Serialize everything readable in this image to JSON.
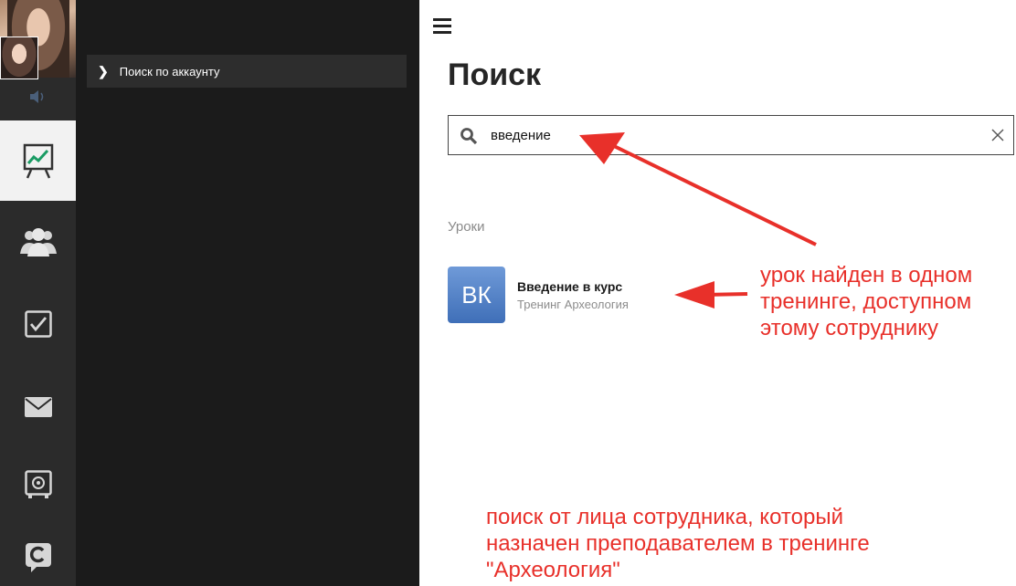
{
  "sidebar": {
    "nav": [
      {
        "label": "Поиск по аккаунту"
      }
    ],
    "icons": [
      "speaker-icon",
      "presentation-chart-icon",
      "users-icon",
      "checkbox-icon",
      "mail-icon",
      "safe-icon",
      "logo-c-icon"
    ]
  },
  "main": {
    "title": "Поиск",
    "search": {
      "value": "введение"
    },
    "section_label": "Уроки",
    "result": {
      "thumb_text": "ВК",
      "title": "Введение в курс",
      "subtitle": "Тренинг Археология"
    }
  },
  "annotations": {
    "right": [
      "урок найден в одном",
      "тренинге, доступном",
      "этому сотруднику"
    ],
    "bottom": [
      "поиск от лица сотрудника, который",
      "назначен преподавателем в тренинге",
      "\"Археология\""
    ]
  },
  "colors": {
    "accent_red": "#e8302a",
    "rail": "#2b2b2b",
    "panel": "#1b1b1b",
    "thumb": "#4a79c3"
  }
}
